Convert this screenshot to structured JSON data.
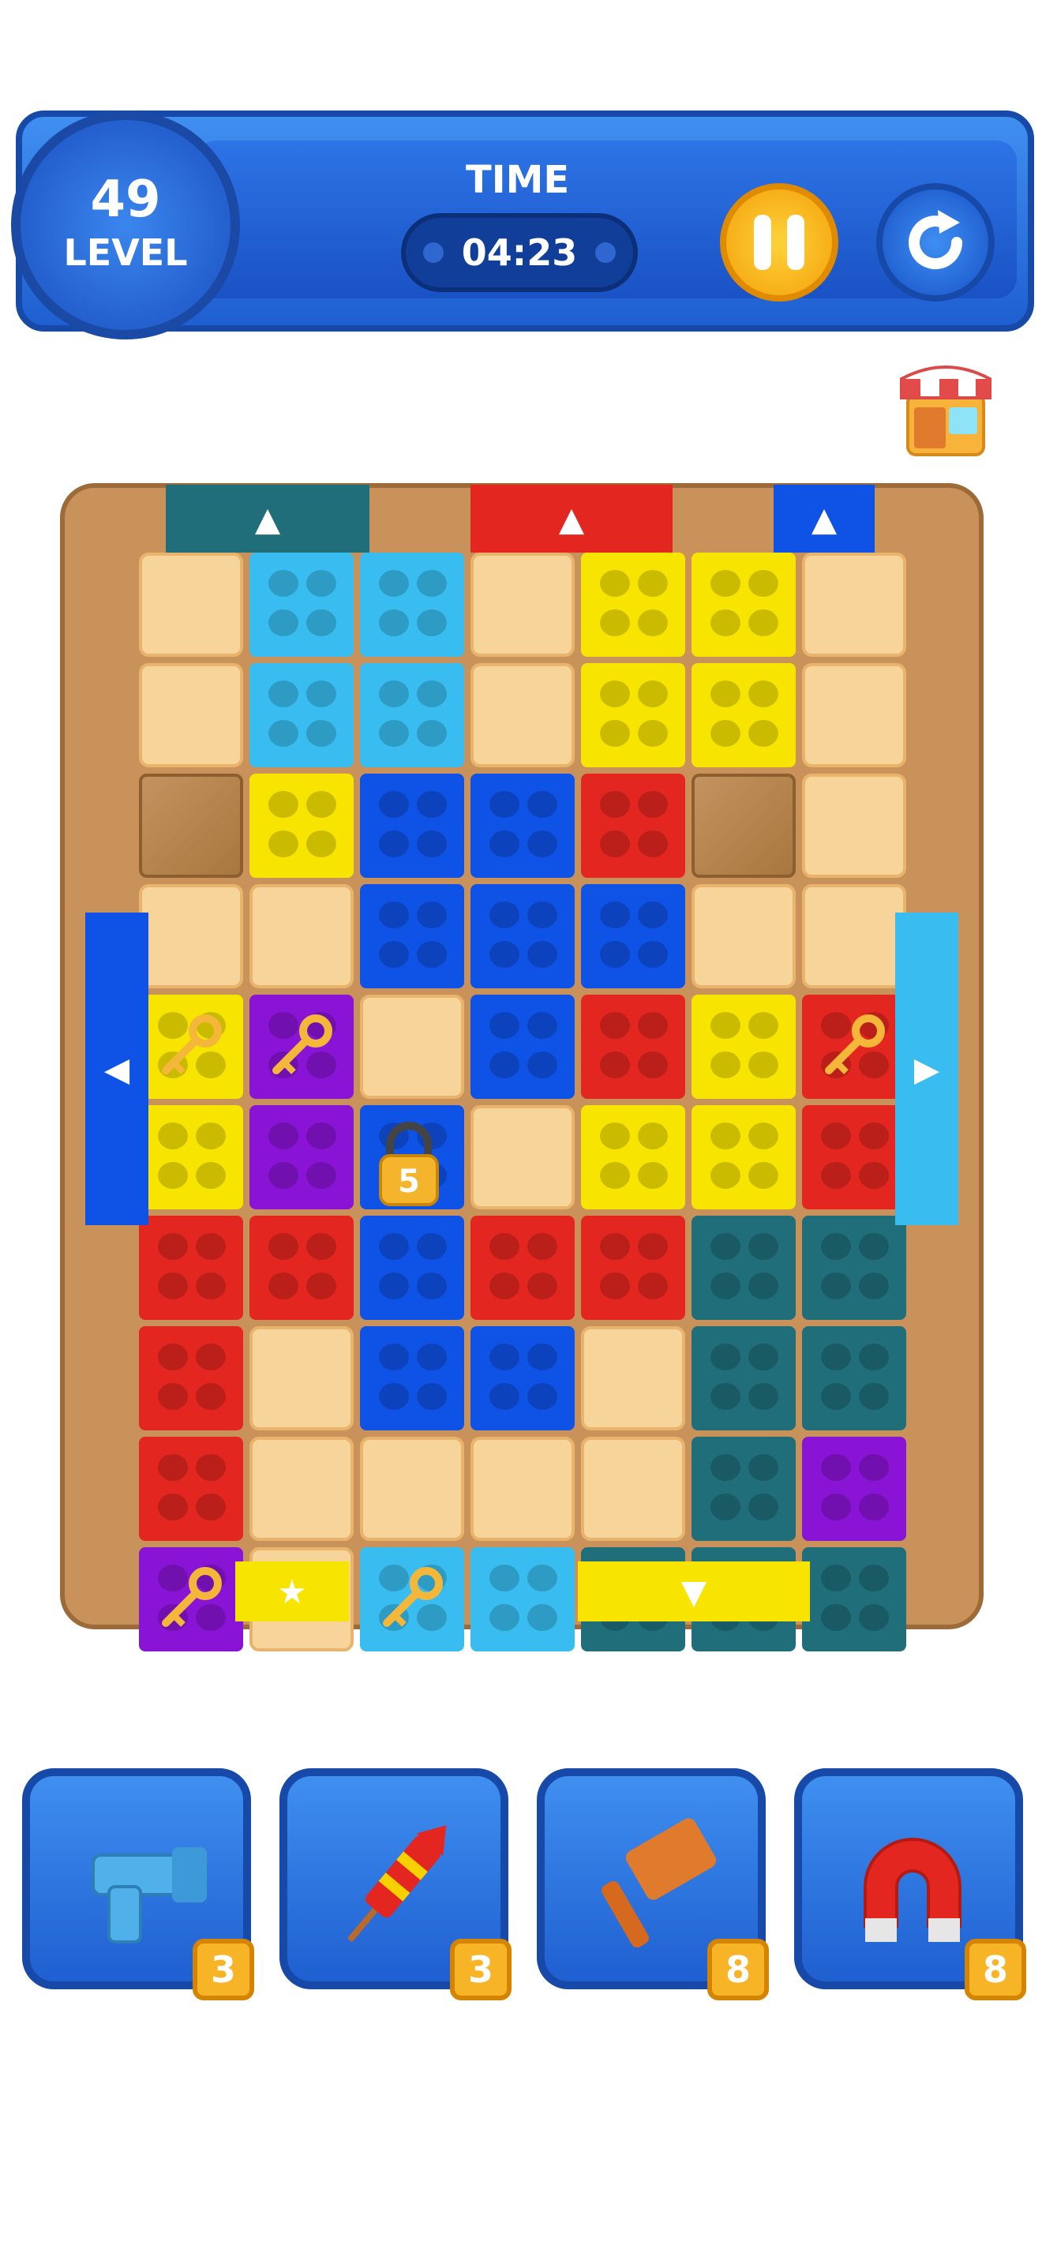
{
  "hud": {
    "level_number": "49",
    "level_label": "LEVEL",
    "time_label": "TIME",
    "time_value": "04:23"
  },
  "lock": {
    "count": "5"
  },
  "powerups": [
    {
      "name": "blaster",
      "count": "3"
    },
    {
      "name": "rocket",
      "count": "3"
    },
    {
      "name": "hammer",
      "count": "8"
    },
    {
      "name": "magnet",
      "count": "8"
    }
  ],
  "colors": {
    "red": "#e3261f",
    "yellow": "#f7e400",
    "blue": "#0f52e6",
    "cyan": "#39bdf0",
    "teal": "#1f6e7a",
    "purple": "#8a14d6"
  }
}
